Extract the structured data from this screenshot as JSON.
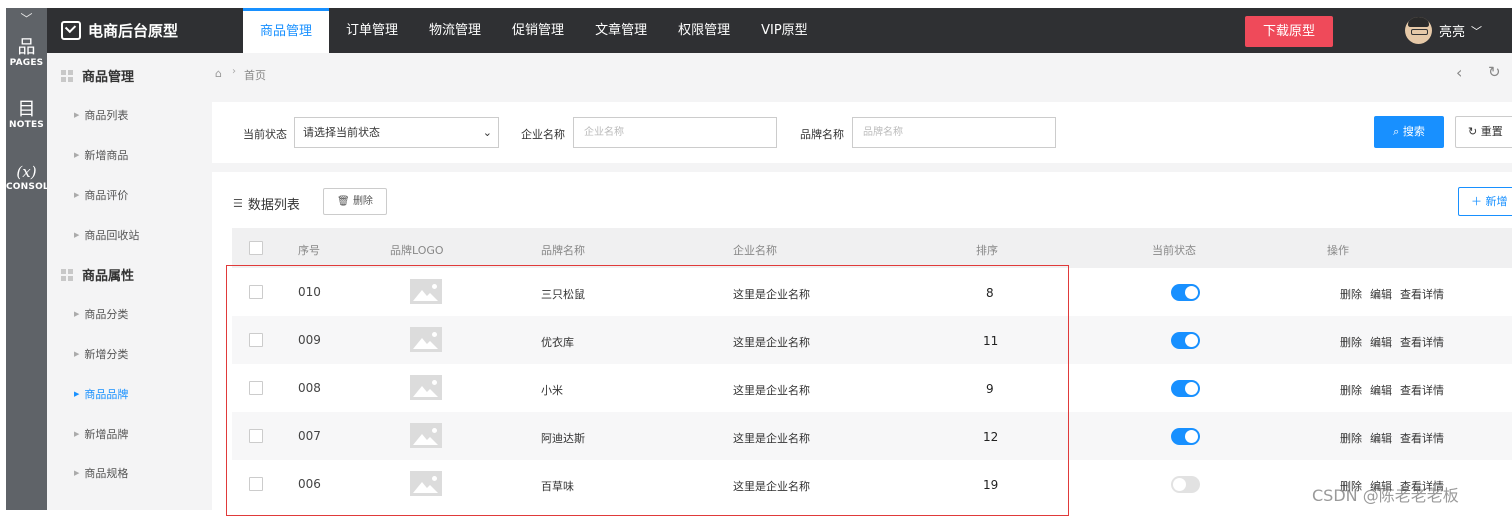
{
  "rail": {
    "items": [
      {
        "icon": "sitemap-icon",
        "glyph": "品",
        "label": "PAGES"
      },
      {
        "icon": "notes-icon",
        "glyph": "目",
        "label": "NOTES"
      },
      {
        "icon": "console-icon",
        "glyph": "(x)",
        "label": "CONSOL"
      }
    ]
  },
  "header": {
    "brand": "电商后台原型",
    "tabs": [
      "商品管理",
      "订单管理",
      "物流管理",
      "促销管理",
      "文章管理",
      "权限管理",
      "VIP原型"
    ],
    "active_tab": "商品管理",
    "download_label": "下载原型",
    "user_name": "亮亮",
    "accent_color": "#1890ff",
    "download_color": "#ef4a5a"
  },
  "sidebar": {
    "groups": [
      {
        "label": "商品管理",
        "items": [
          "商品列表",
          "新增商品",
          "商品评价",
          "商品回收站"
        ]
      },
      {
        "label": "商品属性",
        "items": [
          "商品分类",
          "新增分类",
          "商品品牌",
          "新增品牌",
          "商品规格"
        ]
      }
    ],
    "active_item": "商品品牌"
  },
  "breadcrumb": {
    "home": "首页"
  },
  "search": {
    "status_label": "当前状态",
    "status_value": "请选择当前状态",
    "company_label": "企业名称",
    "company_placeholder": "企业名称",
    "brand_label": "品牌名称",
    "brand_placeholder": "品牌名称",
    "search_button": "搜索",
    "reset_button": "重置"
  },
  "list": {
    "title": "数据列表",
    "delete_button": "删除",
    "add_button": "新增",
    "columns": [
      "序号",
      "品牌LOGO",
      "品牌名称",
      "企业名称",
      "排序",
      "当前状态",
      "操作"
    ],
    "rows": [
      {
        "id": "010",
        "brand": "三只松鼠",
        "company": "这里是企业名称",
        "sort": "8",
        "enabled": true
      },
      {
        "id": "009",
        "brand": "优衣库",
        "company": "这里是企业名称",
        "sort": "11",
        "enabled": true
      },
      {
        "id": "008",
        "brand": "小米",
        "company": "这里是企业名称",
        "sort": "9",
        "enabled": true
      },
      {
        "id": "007",
        "brand": "阿迪达斯",
        "company": "这里是企业名称",
        "sort": "12",
        "enabled": true
      },
      {
        "id": "006",
        "brand": "百草味",
        "company": "这里是企业名称",
        "sort": "19",
        "enabled": false
      }
    ],
    "row_actions": [
      "删除",
      "编辑",
      "查看详情"
    ]
  },
  "watermark": "CSDN @陈老老老板"
}
